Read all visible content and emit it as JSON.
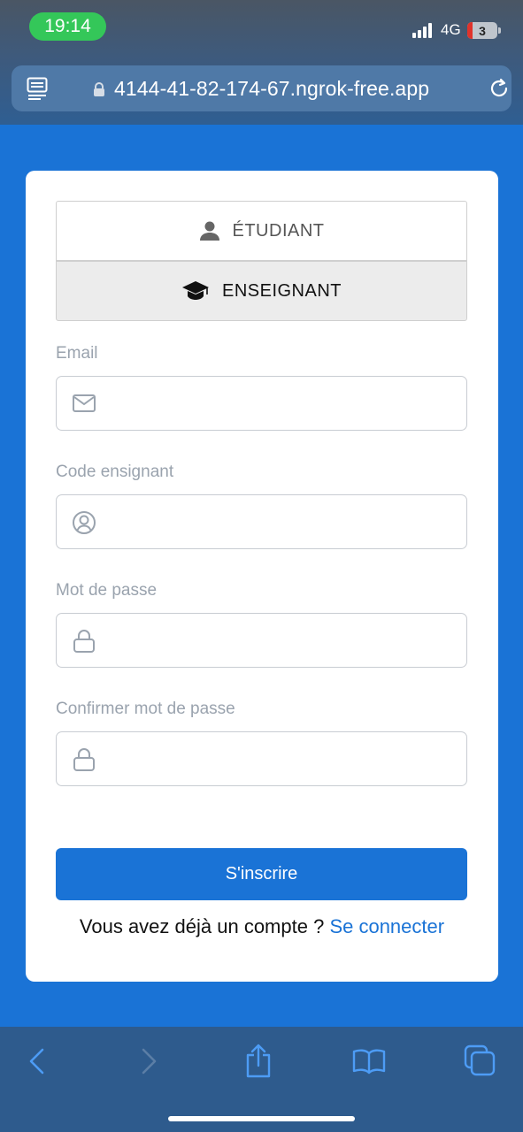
{
  "status_bar": {
    "time": "19:14",
    "network": "4G",
    "battery": "3"
  },
  "browser": {
    "url": "4144-41-82-174-67.ngrok-free.app"
  },
  "form": {
    "roles": [
      {
        "label": "ÉTUDIANT",
        "icon": "person-icon",
        "selected": false
      },
      {
        "label": "ENSEIGNANT",
        "icon": "graduation-cap-icon",
        "selected": true
      }
    ],
    "fields": [
      {
        "label": "Email",
        "icon": "mail-icon",
        "value": ""
      },
      {
        "label": "Code ensignant",
        "icon": "user-circle-icon",
        "value": ""
      },
      {
        "label": "Mot de passe",
        "icon": "lock-icon",
        "value": ""
      },
      {
        "label": "Confirmer mot de passe",
        "icon": "lock-icon",
        "value": ""
      }
    ],
    "submit_label": "S'inscrire",
    "signin_prompt": "Vous avez déjà un compte ? ",
    "signin_link": "Se connecter"
  },
  "colors": {
    "primary": "#1a73d6",
    "toolbar": "#2e5b8d",
    "status_pill": "#34c759"
  }
}
